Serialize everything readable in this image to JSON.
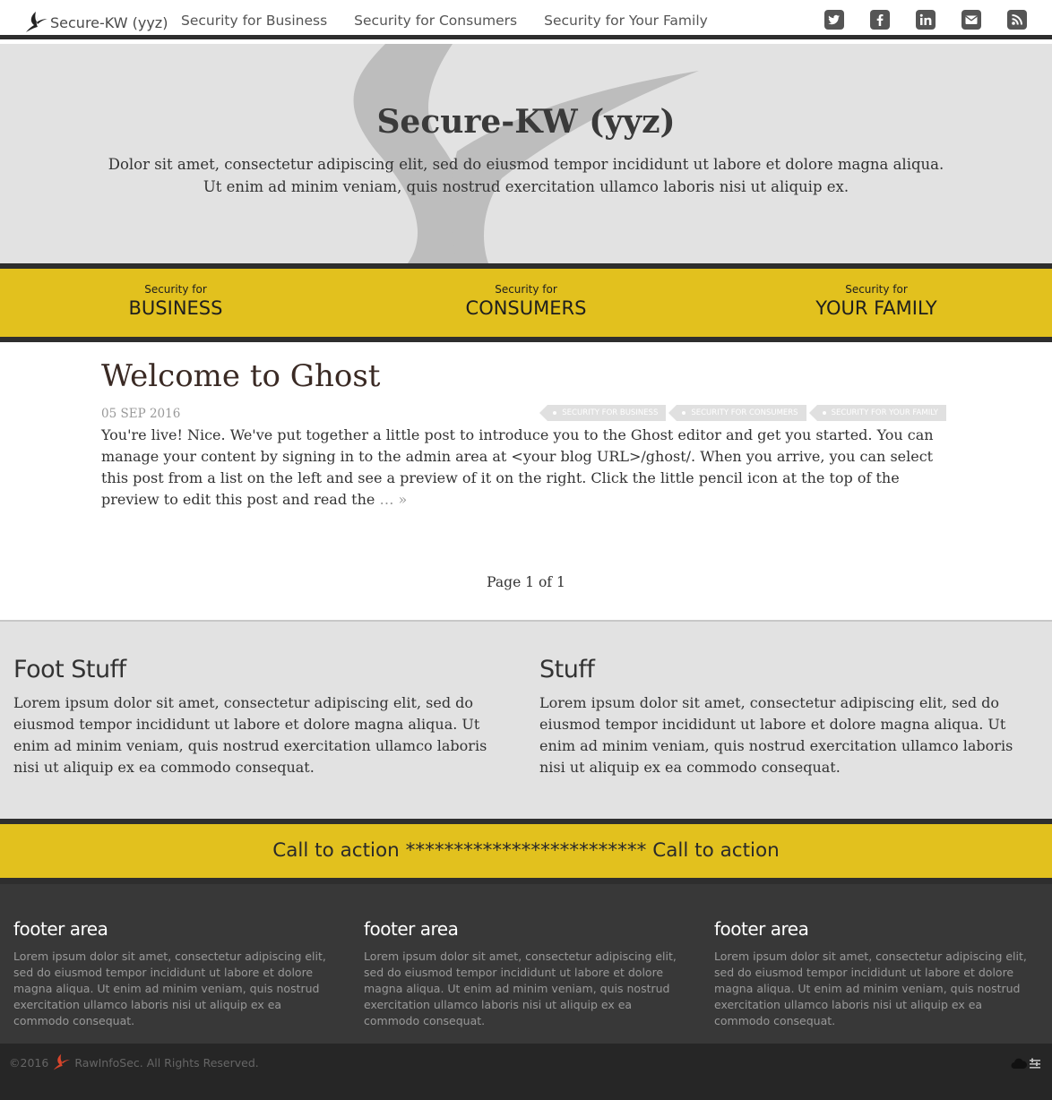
{
  "nav": {
    "brand": "Secure-KW (yyz)",
    "links": [
      "Security for Business",
      "Security for Consumers",
      "Security for Your Family"
    ],
    "social_icons": [
      "twitter-icon",
      "facebook-icon",
      "linkedin-icon",
      "email-icon",
      "rss-icon"
    ]
  },
  "hero": {
    "title": "Secure-KW (yyz)",
    "subtitle_line1": "Dolor sit amet, consectetur adipiscing elit, sed do eiusmod tempor incididunt ut labore et dolore magna aliqua.",
    "subtitle_line2": "Ut enim ad minim veniam, quis nostrud exercitation ullamco laboris nisi ut aliquip ex."
  },
  "categories": [
    {
      "small": "Security for",
      "big": "BUSINESS"
    },
    {
      "small": "Security for",
      "big": "CONSUMERS"
    },
    {
      "small": "Security for",
      "big": "YOUR FAMILY"
    }
  ],
  "post": {
    "title": "Welcome to Ghost",
    "date": "05 SEP 2016",
    "tags": [
      "SECURITY FOR BUSINESS",
      "SECURITY FOR CONSUMERS",
      "SECURITY FOR YOUR FAMILY"
    ],
    "excerpt": "You're live! Nice. We've put together a little post to introduce you to the Ghost editor and get you started. You can manage your content by signing in to the admin area at <your blog URL>/ghost/. When you arrive, you can select this post from a list on the left and see a preview of it on the right. Click the little pencil icon at the top of the preview to edit this post and read the",
    "more": "… »"
  },
  "pagination": "Page 1 of 1",
  "foot_stuff": [
    {
      "heading": "Foot Stuff",
      "text": "Lorem ipsum dolor sit amet, consectetur adipiscing elit, sed do eiusmod tempor incididunt ut labore et dolore magna aliqua. Ut enim ad minim veniam, quis nostrud exercitation ullamco laboris nisi ut aliquip ex ea commodo consequat."
    },
    {
      "heading": "Stuff",
      "text": "Lorem ipsum dolor sit amet, consectetur adipiscing elit, sed do eiusmod tempor incididunt ut labore et dolore magna aliqua. Ut enim ad minim veniam, quis nostrud exercitation ullamco laboris nisi ut aliquip ex ea commodo consequat."
    }
  ],
  "cta": "Call to action ************************* Call to action",
  "footer_area": [
    {
      "heading": "footer area",
      "text": "Lorem ipsum dolor sit amet, consectetur adipiscing elit, sed do eiusmod tempor incididunt ut labore et dolore magna aliqua. Ut enim ad minim veniam, quis nostrud exercitation ullamco laboris nisi ut aliquip ex ea commodo consequat."
    },
    {
      "heading": "footer area",
      "text": "Lorem ipsum dolor sit amet, consectetur adipiscing elit, sed do eiusmod tempor incididunt ut labore et dolore magna aliqua. Ut enim ad minim veniam, quis nostrud exercitation ullamco laboris nisi ut aliquip ex ea commodo consequat."
    },
    {
      "heading": "footer area",
      "text": "Lorem ipsum dolor sit amet, consectetur adipiscing elit, sed do eiusmod tempor incididunt ut labore et dolore magna aliqua. Ut enim ad minim veniam, quis nostrud exercitation ullamco laboris nisi ut aliquip ex ea commodo consequat."
    }
  ],
  "bottom": {
    "copyright_year": "©2016",
    "company": "RawInfoSec. All Rights Reserved."
  },
  "colors": {
    "accent_yellow": "#e2c11e",
    "dark_band": "#2e2e2e",
    "hero_bg": "#e2e2e2",
    "footer_bg": "#383838",
    "bottom_bg": "#262626",
    "logo_red": "#d9452b"
  }
}
